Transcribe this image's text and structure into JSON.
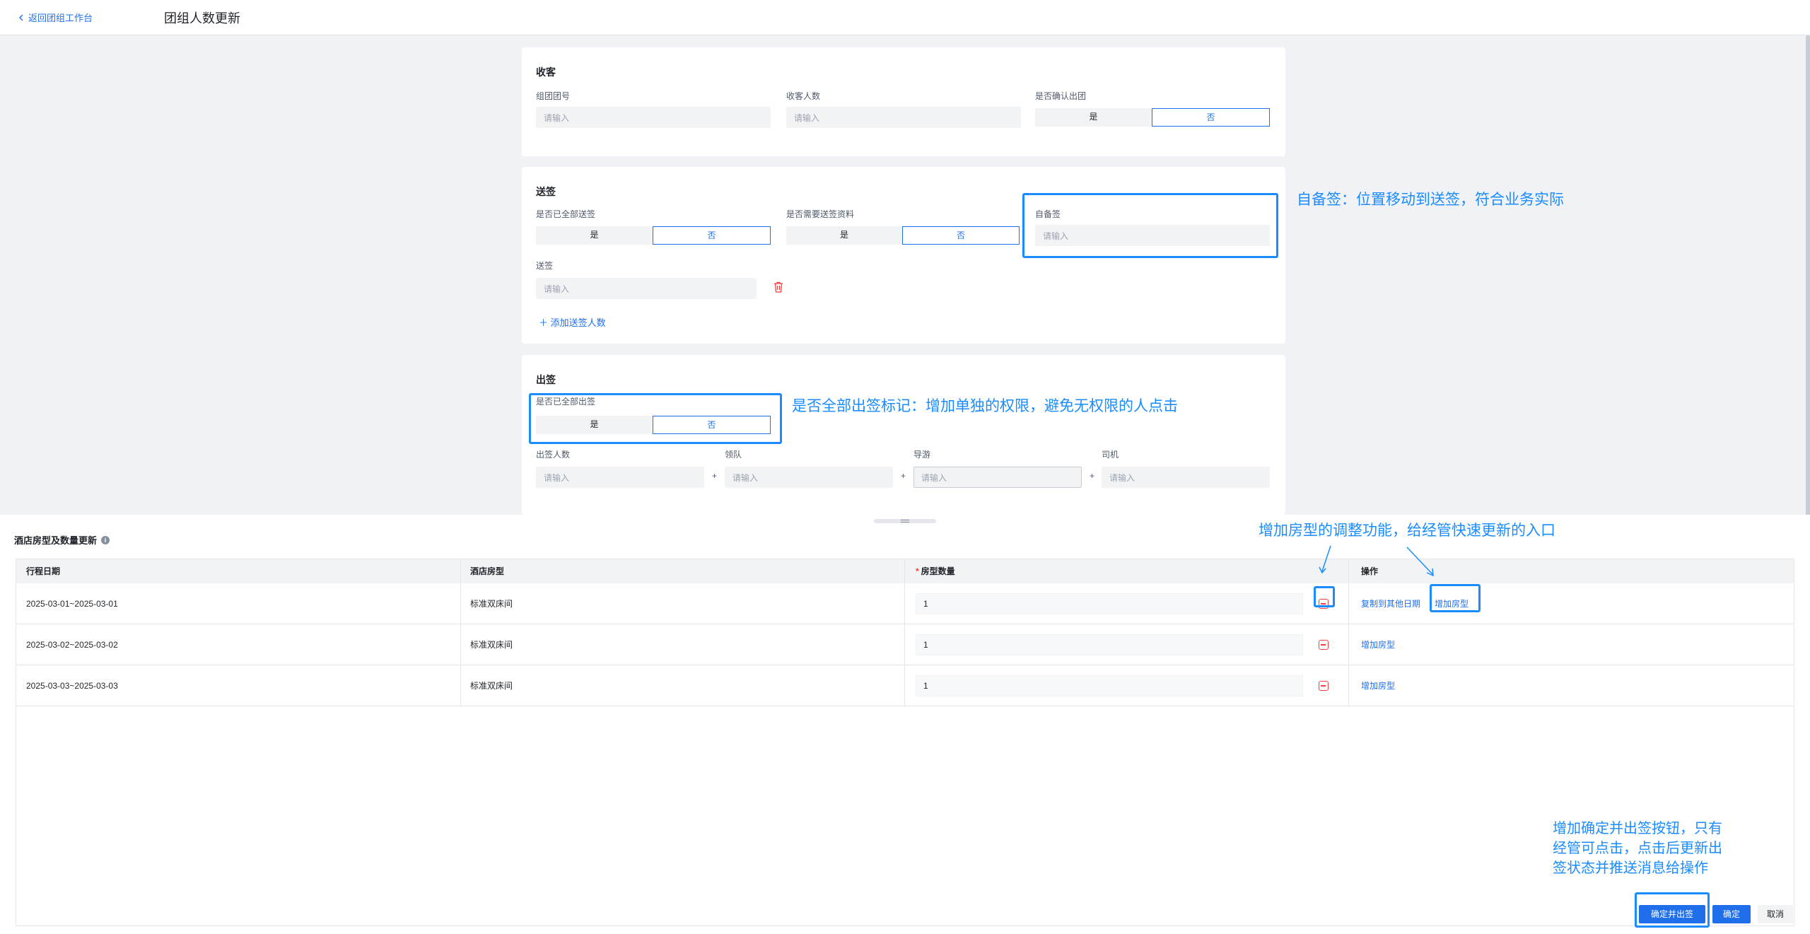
{
  "header": {
    "back_label": "返回团组工作台",
    "title": "团组人数更新"
  },
  "receive": {
    "title": "收客",
    "group_no_label": "组团团号",
    "group_no_placeholder": "请输入",
    "guest_count_label": "收客人数",
    "guest_count_placeholder": "请输入",
    "confirm_label": "是否确认出团",
    "yes": "是",
    "no": "否"
  },
  "visa_send": {
    "title": "送签",
    "all_sent_label": "是否已全部送签",
    "need_docs_label": "是否需要送签资料",
    "self_visa_label": "自备签",
    "self_visa_placeholder": "请输入",
    "send_label": "送签",
    "send_placeholder": "请输入",
    "add_label": "添加送签人数",
    "yes": "是",
    "no": "否"
  },
  "visa_out": {
    "title": "出签",
    "all_out_label": "是否已全部出签",
    "count_label": "出签人数",
    "leader_label": "领队",
    "guide_label": "导游",
    "driver_label": "司机",
    "placeholder": "请输入",
    "plus": "+",
    "yes": "是",
    "no": "否"
  },
  "annotations": {
    "self_visa": "自备签：位置移动到送签，符合业务实际",
    "all_out": "是否全部出签标记：增加单独的权限，避免无权限的人点击",
    "room_adjust": "增加房型的调整功能，给经管快速更新的入口",
    "confirm_out_line1": "增加确定并出签按钮，只有",
    "confirm_out_line2": "经管可点击，点击后更新出",
    "confirm_out_line3": "签状态并推送消息给操作"
  },
  "hotel": {
    "title": "酒店房型及数量更新",
    "info_icon": "i",
    "columns": {
      "date": "行程日期",
      "room": "酒店房型",
      "required": "*",
      "qty": "房型数量",
      "ops": "操作"
    },
    "rows": [
      {
        "date": "2025-03-01~2025-03-01",
        "room": "标准双床间",
        "qty": "1",
        "op1": "复制到其他日期",
        "op2": "增加房型"
      },
      {
        "date": "2025-03-02~2025-03-02",
        "room": "标准双床间",
        "qty": "1",
        "op1": "增加房型"
      },
      {
        "date": "2025-03-03~2025-03-03",
        "room": "标准双床间",
        "qty": "1",
        "op1": "增加房型"
      }
    ]
  },
  "footer": {
    "confirm_out": "确定并出签",
    "confirm": "确定",
    "cancel": "取消"
  },
  "colors": {
    "accent": "#1f6feb",
    "annotation": "#1a8cff",
    "danger": "#f53f3f"
  }
}
